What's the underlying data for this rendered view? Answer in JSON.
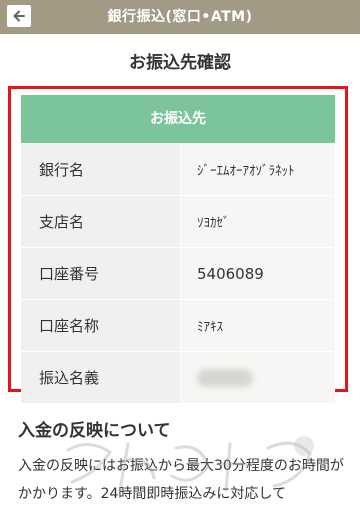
{
  "header": {
    "title": "銀行振込(窓口•ATM)",
    "back_icon": "arrow-left-icon",
    "bar_color": "#a39a86"
  },
  "page": {
    "title": "お振込先確認"
  },
  "transfer_table": {
    "heading": "お振込先",
    "heading_color": "#7cc59b",
    "highlight_color": "#e8141c",
    "rows": [
      {
        "label": "銀行名",
        "value": "ｼﾞｰｴﾑｵｰｱｵｿﾞﾗﾈｯﾄ"
      },
      {
        "label": "支店名",
        "value": "ｿﾖｶｾﾞ"
      },
      {
        "label": "口座番号",
        "value": "5406089"
      },
      {
        "label": "口座名称",
        "value": "ﾐｱｷｽ"
      },
      {
        "label": "振込名義",
        "value": ""
      }
    ]
  },
  "reflection": {
    "title": "入金の反映について",
    "text": "入金の反映にはお振込から最大30分程度のお時間がかかります。24時間即時振込みに対応して"
  }
}
